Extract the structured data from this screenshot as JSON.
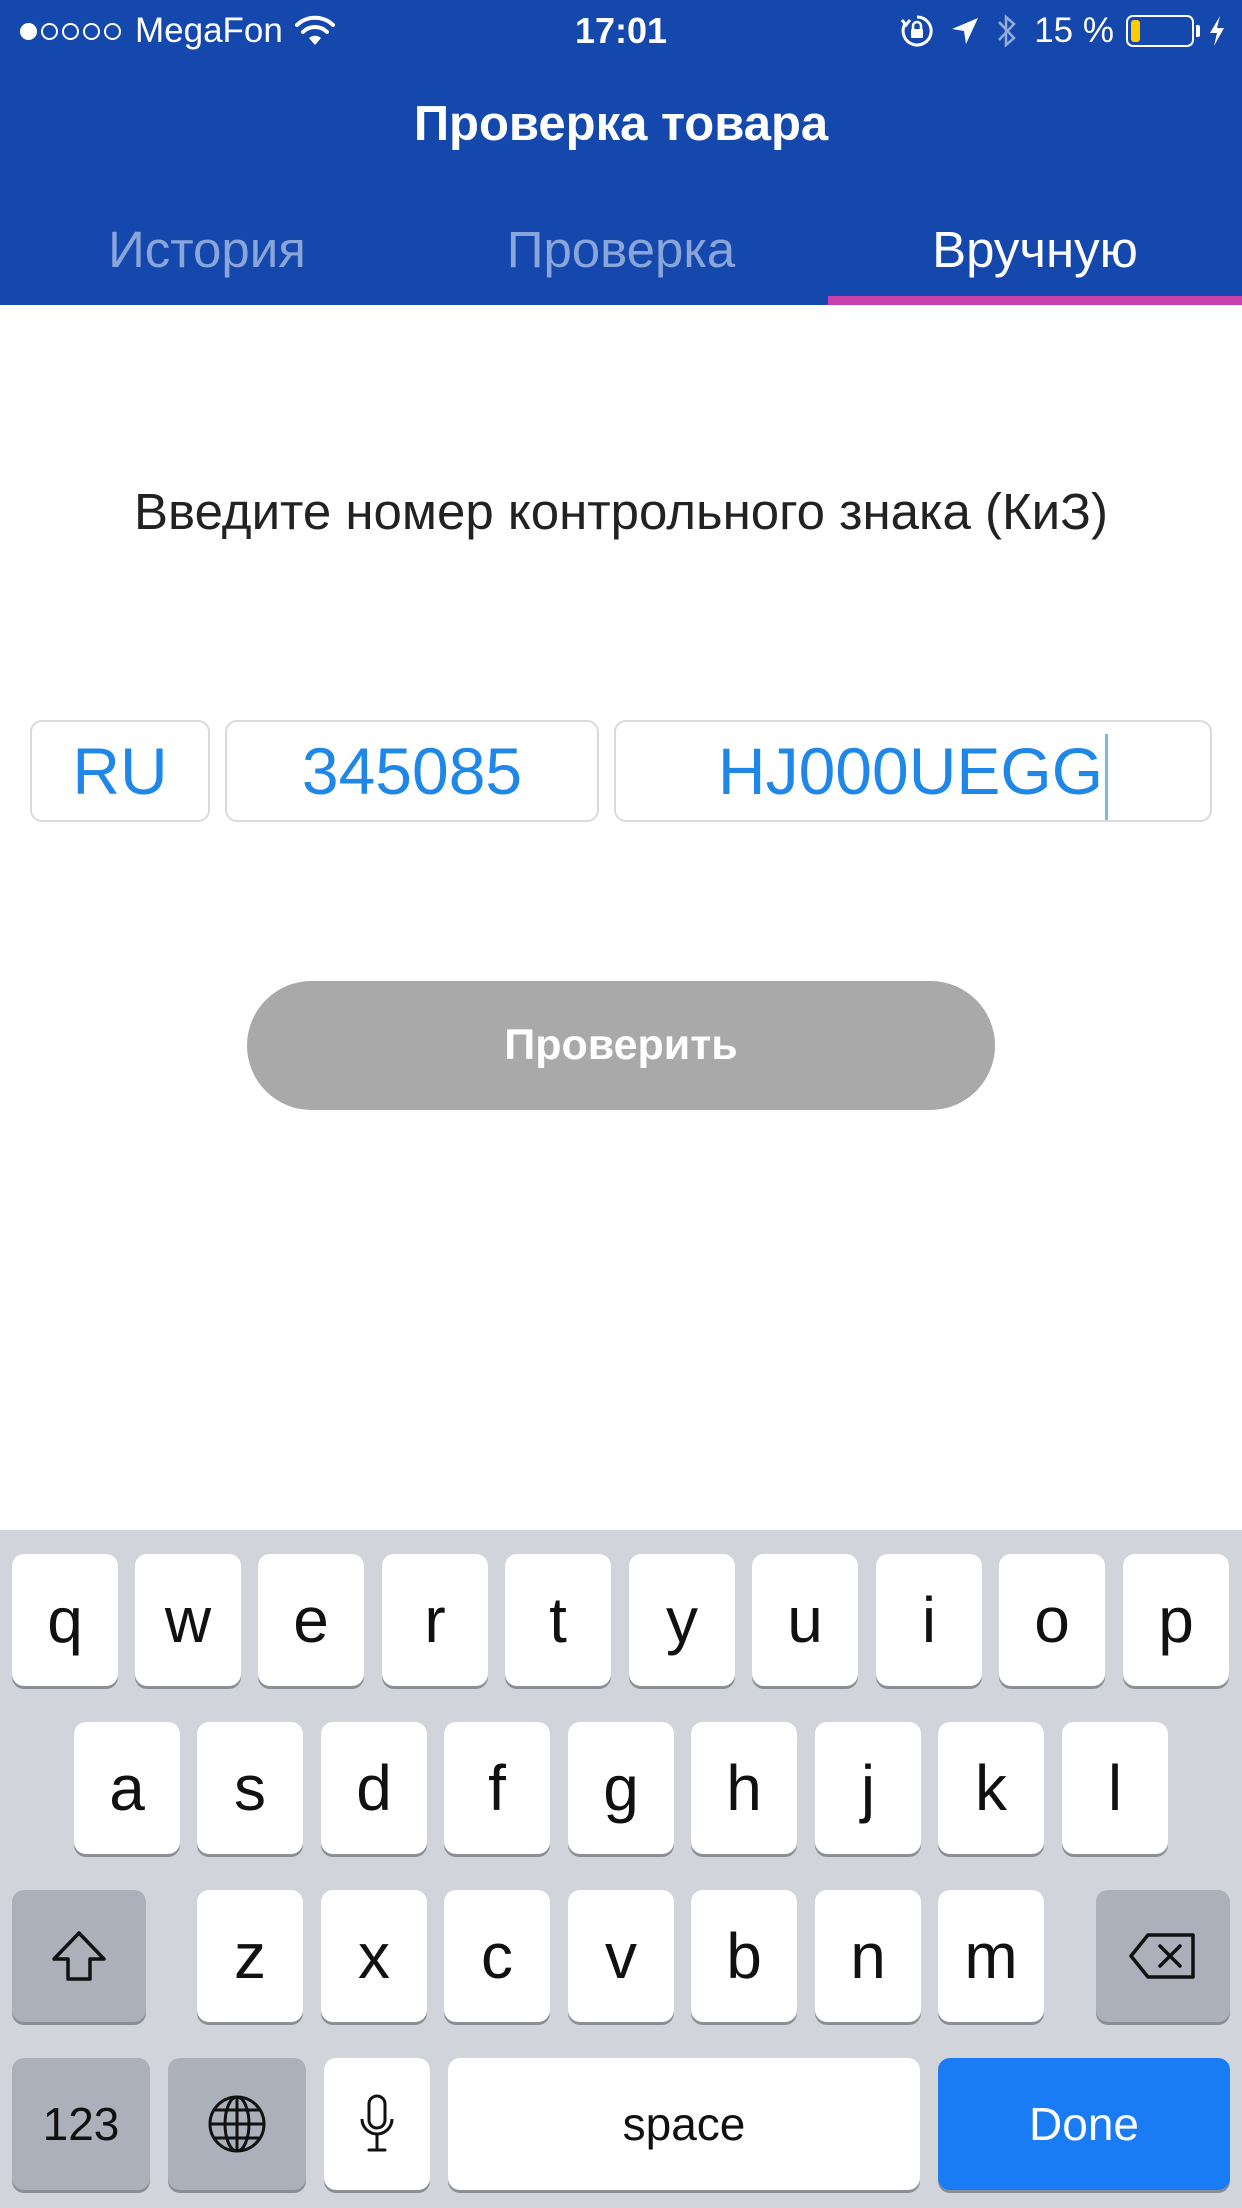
{
  "status_bar": {
    "carrier": "MegaFon",
    "time": "17:01",
    "battery_percent": "15 %",
    "battery_level": 0.15,
    "signal_dots_filled": 1,
    "signal_dots_total": 5,
    "icons": [
      "signal-dots-icon",
      "wifi-icon",
      "orientation-lock-icon",
      "location-arrow-icon",
      "bluetooth-icon",
      "battery-icon",
      "charging-bolt-icon"
    ]
  },
  "nav": {
    "title": "Проверка товара"
  },
  "tabs": [
    {
      "label": "История",
      "active": false
    },
    {
      "label": "Проверка",
      "active": false
    },
    {
      "label": "Вручную",
      "active": true
    }
  ],
  "main": {
    "prompt": "Введите номер контрольного знака (КиЗ)",
    "fields": {
      "country": "RU",
      "code": "345085",
      "serial": "HJ000UEGG"
    },
    "check_button_label": "Проверить"
  },
  "keyboard": {
    "row1": [
      "q",
      "w",
      "e",
      "r",
      "t",
      "y",
      "u",
      "i",
      "o",
      "p"
    ],
    "row2": [
      "a",
      "s",
      "d",
      "f",
      "g",
      "h",
      "j",
      "k",
      "l"
    ],
    "row3": [
      "z",
      "x",
      "c",
      "v",
      "b",
      "n",
      "m"
    ],
    "numbers_label": "123",
    "space_label": "space",
    "done_label": "Done",
    "icons": [
      "shift-icon",
      "backspace-icon",
      "globe-icon",
      "microphone-icon"
    ]
  },
  "colors": {
    "header_bg": "#1548ad",
    "tab_indicator": "#c941ad",
    "field_text": "#1e87e8",
    "button_disabled": "#a9a9a9",
    "done_key": "#1a7cf5"
  }
}
